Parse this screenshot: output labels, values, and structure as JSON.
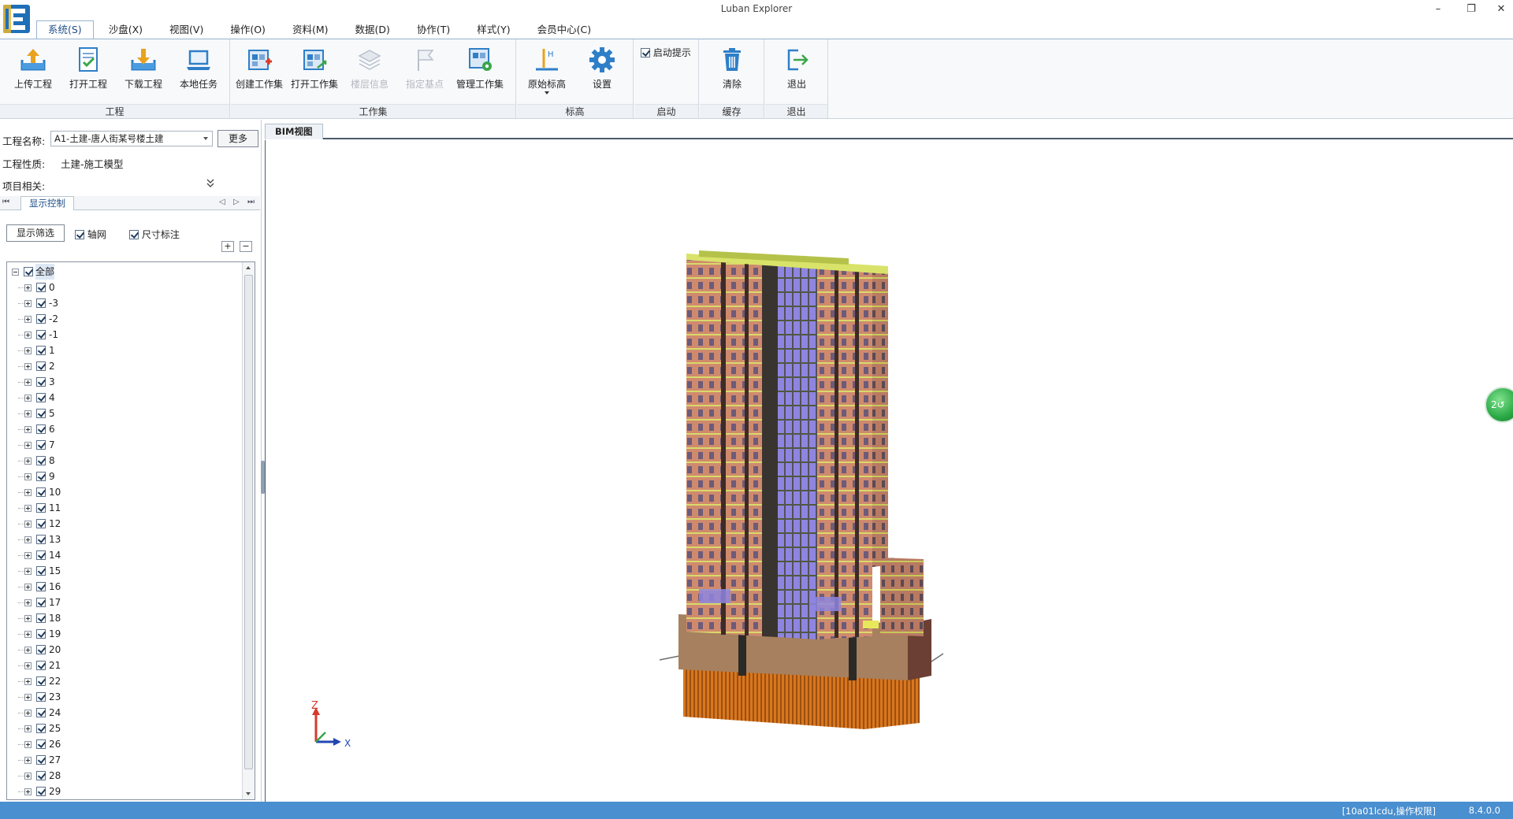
{
  "window": {
    "title": "Luban Explorer",
    "controls": [
      "–",
      "❐",
      "✕"
    ]
  },
  "menu": {
    "tabs": [
      {
        "label": "系统(S)",
        "active": true
      },
      {
        "label": "沙盘(X)"
      },
      {
        "label": "视图(V)"
      },
      {
        "label": "操作(O)"
      },
      {
        "label": "资料(M)"
      },
      {
        "label": "数据(D)"
      },
      {
        "label": "协作(T)"
      },
      {
        "label": "样式(Y)"
      },
      {
        "label": "会员中心(C)"
      }
    ]
  },
  "ribbon": {
    "groups": {
      "project": {
        "label": "工程",
        "buttons": {
          "upload": "上传工程",
          "open": "打开工程",
          "download": "下载工程",
          "local_tasks": "本地任务"
        }
      },
      "workset": {
        "label": "工作集",
        "buttons": {
          "create": "创建工作集",
          "open": "打开工作集",
          "floor_info": "楼层信息",
          "base_point": "指定基点",
          "manage": "管理工作集"
        }
      },
      "elevation": {
        "label": "标高",
        "buttons": {
          "original": "原始标高",
          "settings": "设置"
        }
      },
      "startup": {
        "label": "启动",
        "checkbox_label": "启动提示",
        "checked": true
      },
      "cache": {
        "label": "缓存",
        "buttons": {
          "clear": "清除"
        }
      },
      "exit": {
        "label": "退出",
        "buttons": {
          "exit": "退出"
        }
      }
    }
  },
  "left_panel": {
    "project_name_label": "工程名称:",
    "project_name_value": "A1-土建-唐人街某号楼土建",
    "more_button": "更多",
    "project_type_label": "工程性质:",
    "project_type_value": "土建-施工模型",
    "project_related_label": "项目相关:",
    "display_tab": "显示控制",
    "filter_button": "显示筛选",
    "grid_label": "轴网",
    "dimension_label": "尺寸标注",
    "expand_button": "+",
    "collapse_button": "−",
    "tree_root": "全部",
    "tree_items": [
      "0",
      "-3",
      "-2",
      "-1",
      "1",
      "2",
      "3",
      "4",
      "5",
      "6",
      "7",
      "8",
      "9",
      "10",
      "11",
      "12",
      "13",
      "14",
      "15",
      "16",
      "17",
      "18",
      "19",
      "20",
      "21",
      "22",
      "23",
      "24",
      "25",
      "26",
      "27",
      "28",
      "29"
    ]
  },
  "viewport": {
    "tab_label": "BIM视图",
    "axis_z": "Z",
    "axis_x": "X",
    "nav_ball_label": "2↺"
  },
  "status": {
    "user": "[10a01lcdu,操作权限]",
    "version": "8.4.0.0"
  },
  "colors": {
    "accent": "#4a8fcf",
    "facade": "#cf8a6e",
    "glass": "#8e85e0",
    "slab": "#e8e85c",
    "piles": "#d8771f",
    "podium": "#a6805f"
  }
}
